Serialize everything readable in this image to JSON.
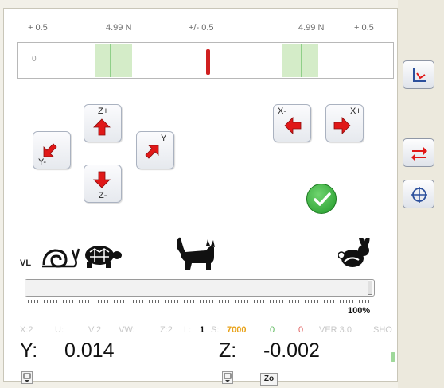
{
  "scale": {
    "left_limit": "+ 0.5",
    "left_force": "4.99 N",
    "center": "+/- 0.5",
    "right_force": "4.99 N",
    "right_limit": "+ 0.5",
    "bar_value": "0"
  },
  "jog": {
    "y_minus": "Y-",
    "z_plus": "Z+",
    "z_minus": "Z-",
    "y_plus": "Y+",
    "x_minus": "X-",
    "x_plus": "X+"
  },
  "speed": {
    "label": "VL",
    "percent_label": "100%",
    "level_percent": 100
  },
  "status": {
    "x": "X:2",
    "u": "U:",
    "v": "V:2",
    "vw": "VW:",
    "z": "Z:2",
    "l": "L:",
    "one": "1",
    "s": "S:",
    "s_value": "7000",
    "g": "0",
    "r": "0",
    "version": "VER 3.0",
    "sho": "SHO"
  },
  "coords": {
    "y_label": "Y:",
    "y_value": "0.014",
    "z_label": "Z:",
    "z_value": "-0.002",
    "zo_label": "Zo"
  },
  "colors": {
    "arrow_red": "#e01818",
    "ok_green": "#2fae36",
    "zone_green": "#d4ecc8"
  },
  "icons": {
    "slow": "snail-icon",
    "medium_slow": "turtle-icon",
    "medium": "cat-icon",
    "fast": "rabbit-icon"
  }
}
